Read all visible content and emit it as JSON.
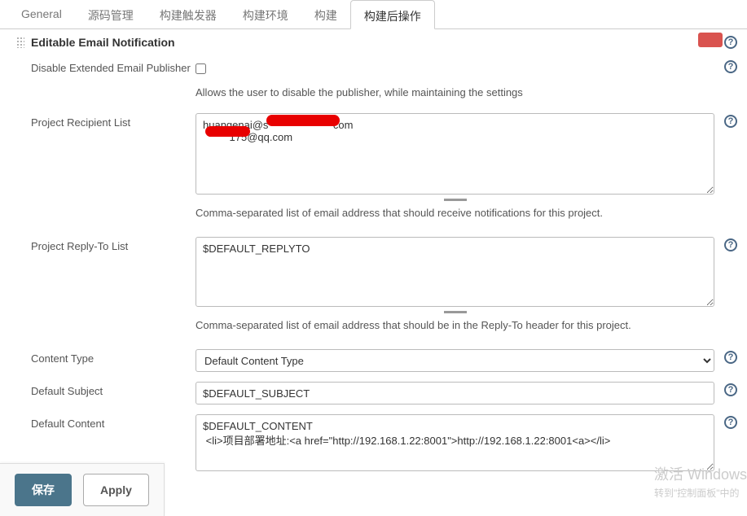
{
  "tabs": {
    "items": [
      "General",
      "源码管理",
      "构建触发器",
      "构建环境",
      "构建",
      "构建后操作"
    ],
    "active": 5
  },
  "section": {
    "title": "Editable Email Notification"
  },
  "fields": {
    "disable": {
      "label": "Disable Extended Email Publisher",
      "desc": "Allows the user to disable the publisher, while maintaining the settings"
    },
    "recipient": {
      "label": "Project Recipient List",
      "value": "huangenai@s                      com\n         175@qq.com",
      "desc": "Comma-separated list of email address that should receive notifications for this project."
    },
    "replyto": {
      "label": "Project Reply-To List",
      "value": "$DEFAULT_REPLYTO",
      "desc": "Comma-separated list of email address that should be in the Reply-To header for this project."
    },
    "contentType": {
      "label": "Content Type",
      "value": "Default Content Type"
    },
    "subject": {
      "label": "Default Subject",
      "value": "$DEFAULT_SUBJECT"
    },
    "content": {
      "label": "Default Content",
      "value": "$DEFAULT_CONTENT\n <li>项目部署地址:<a href=\"http://192.168.1.22:8001\">http://192.168.1.22:8001<a></li>"
    }
  },
  "buttons": {
    "save": "保存",
    "apply": "Apply"
  },
  "watermark": {
    "title": "激活 Windows",
    "sub": "转到\"控制面板\"中的"
  }
}
